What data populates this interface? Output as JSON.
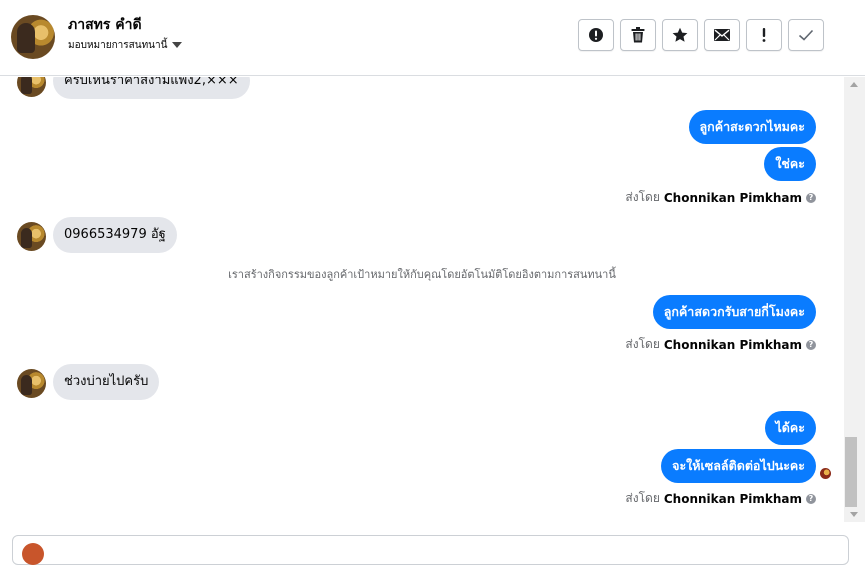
{
  "header": {
    "contact_name": "ภาสทร คำดี",
    "assign_label": "มอบหมายการสนทนานี้",
    "toolbar": [
      {
        "icon": "alert-circle-icon",
        "name": "spam-button"
      },
      {
        "icon": "trash-icon",
        "name": "delete-button"
      },
      {
        "icon": "star-icon",
        "name": "star-button"
      },
      {
        "icon": "envelope-icon",
        "name": "mark-unread-button"
      },
      {
        "icon": "exclamation-icon",
        "name": "follow-up-button"
      },
      {
        "icon": "check-icon",
        "name": "mark-done-button"
      }
    ]
  },
  "messages": [
    {
      "dir": "in",
      "text": "ครบเห็นราคาสงามแพง2,×××"
    },
    {
      "dir": "out",
      "text": "ลูกค้าสะดวกไหมคะ"
    },
    {
      "dir": "out",
      "text": "ใช่คะ"
    },
    {
      "dir": "sent_by",
      "prefix": "ส่งโดย",
      "name": "Chonnikan Pimkham"
    },
    {
      "dir": "in",
      "text": "0966534979 อัฐ"
    },
    {
      "dir": "system",
      "text": "เราสร้างกิจกรรมของลูกค้าเป้าหมายให้กับคุณโดยอัตโนมัติโดยอิงตามการสนทนานี้"
    },
    {
      "dir": "out",
      "text": "ลูกค้าสดวกรับสายกี่โมงคะ"
    },
    {
      "dir": "sent_by",
      "prefix": "ส่งโดย",
      "name": "Chonnikan Pimkham"
    },
    {
      "dir": "in",
      "text": "ช่วงบ่ายไปครับ"
    },
    {
      "dir": "out",
      "text": "ได้คะ"
    },
    {
      "dir": "out",
      "text": "จะให้เซลล์ติดต่อไปนะคะ"
    },
    {
      "dir": "sent_by",
      "prefix": "ส่งโดย",
      "name": "Chonnikan Pimkham"
    }
  ],
  "colors": {
    "outgoing_bubble": "#0a7cff",
    "incoming_bubble": "#e4e6eb"
  }
}
